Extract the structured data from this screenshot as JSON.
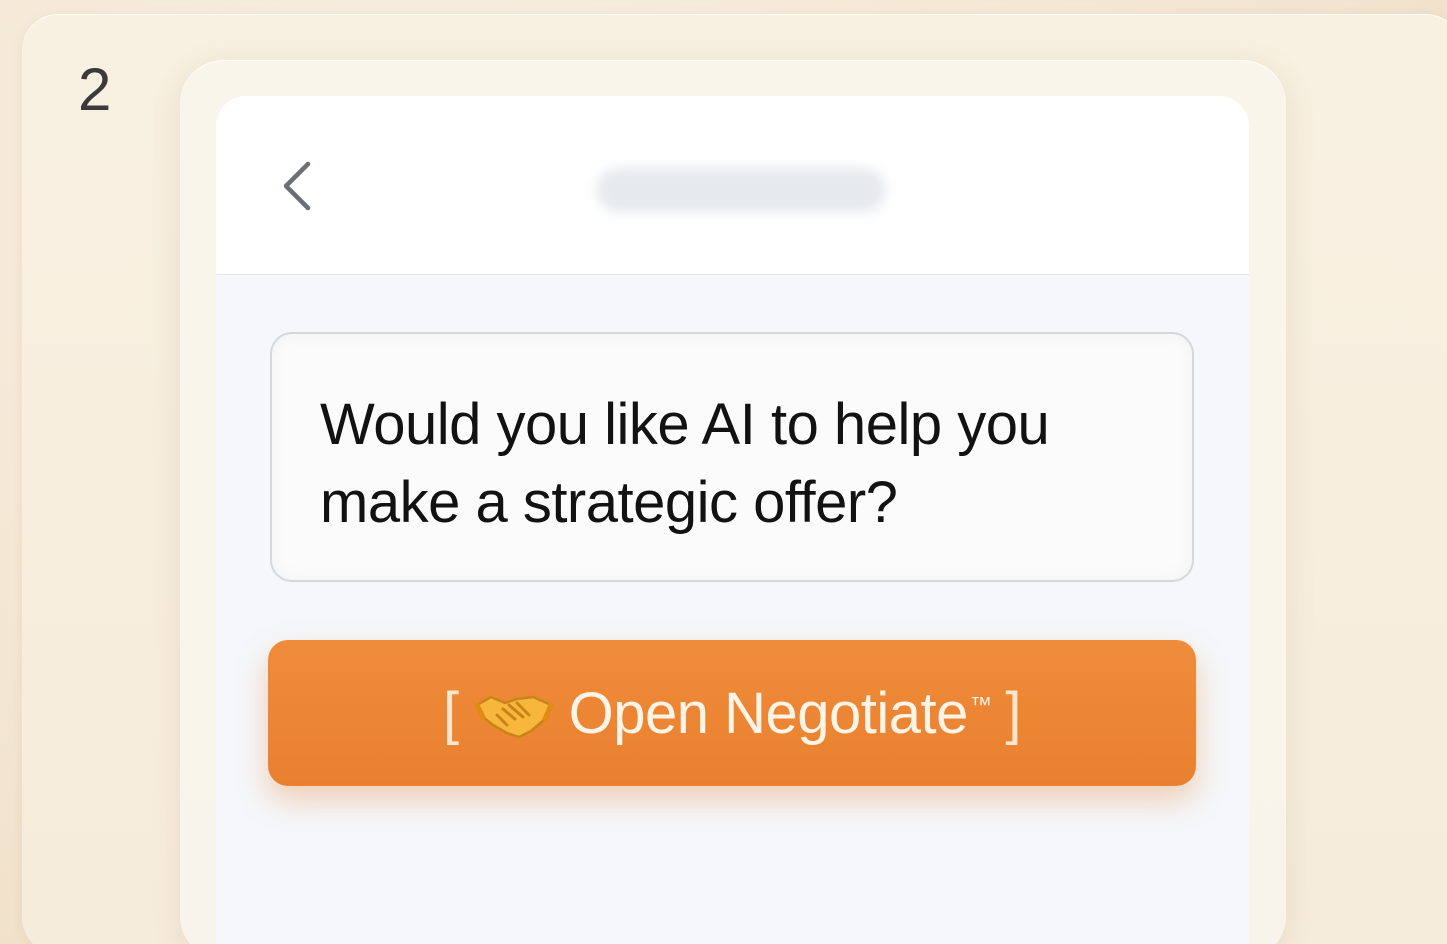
{
  "step": {
    "number": "2"
  },
  "header": {
    "back_icon": "chevron-left-icon",
    "title_blurred": true
  },
  "prompt": {
    "text": "Would you like AI to help you make a strategic offer?"
  },
  "action_button": {
    "open_bracket": "[",
    "icon": "handshake-icon",
    "label": "Open Negotiate",
    "trademark": "™",
    "close_bracket": "]"
  },
  "colors": {
    "background": "#f3e6d2",
    "button": "#ec8634",
    "button_text": "#fff4e6",
    "prompt_text": "#121212",
    "prompt_border": "#d4d8dd"
  }
}
